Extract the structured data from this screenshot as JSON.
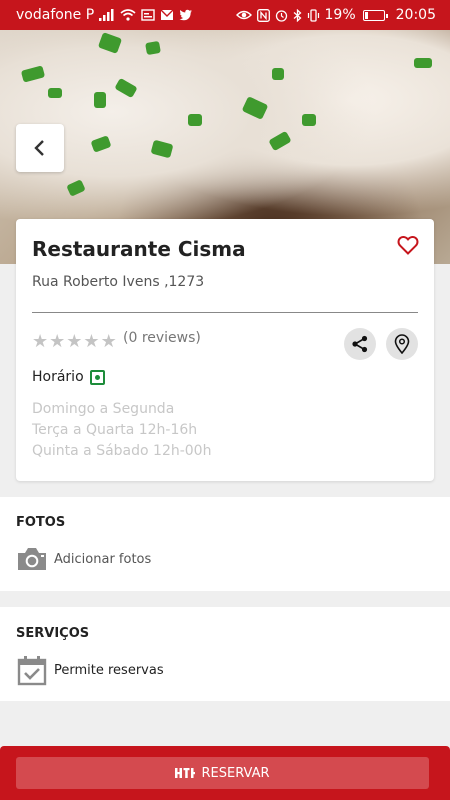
{
  "status_bar": {
    "carrier": "vodafone P",
    "battery": "19%",
    "battery_level": 0.19,
    "time": "20:05"
  },
  "hero": {
    "slides_total": 16,
    "active_slide": 1
  },
  "restaurant": {
    "name": "Restaurante Cisma",
    "address": "Rua Roberto Ivens ,1273",
    "rating": 0,
    "reviews_label": "(0 reviews)",
    "favorite_color": "#c6151c"
  },
  "schedule": {
    "label": "Horário",
    "lines": [
      "Domingo a Segunda",
      "Terça a Quarta 12h-16h",
      "Quinta a Sábado 12h-00h"
    ]
  },
  "photos": {
    "title": "FOTOS",
    "add_label": "Adicionar fotos"
  },
  "services": {
    "title": "SERVIÇOS",
    "items": [
      "Permite reservas"
    ]
  },
  "footer": {
    "reserve_label": "RESERVAR"
  },
  "colors": {
    "brand": "#c6151c",
    "open_status": "#1d8c3a"
  }
}
